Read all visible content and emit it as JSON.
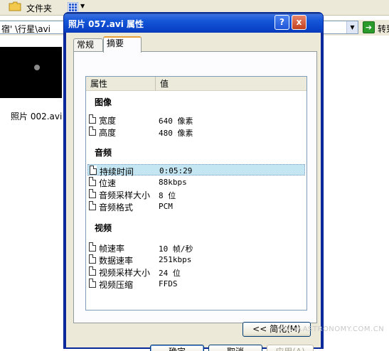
{
  "explorer": {
    "folders_label": "文件夹",
    "address": "宿' \\行星\\avi",
    "go_label": "转到",
    "thumbnail_label": "照片 002.avi"
  },
  "dialog": {
    "title": "照片 057.avi 属性",
    "help_glyph": "?",
    "close_glyph": "x",
    "tabs": [
      {
        "label": "常规"
      },
      {
        "label": "摘要",
        "active": true
      }
    ],
    "columns": {
      "property": "属性",
      "value": "值"
    },
    "groups": {
      "image": {
        "title": "图像",
        "rows": [
          {
            "label": "宽度",
            "value": "640 像素"
          },
          {
            "label": "高度",
            "value": "480 像素"
          }
        ]
      },
      "audio": {
        "title": "音频",
        "rows": [
          {
            "label": "持续时间",
            "value": "0:05:29",
            "selected": true
          },
          {
            "label": "位速",
            "value": "88kbps"
          },
          {
            "label": "音频采样大小",
            "value": "8 位"
          },
          {
            "label": "音频格式",
            "value": "PCM"
          }
        ]
      },
      "video": {
        "title": "视频",
        "rows": [
          {
            "label": "帧速率",
            "value": "10 帧/秒"
          },
          {
            "label": "数据速率",
            "value": "251kbps"
          },
          {
            "label": "视频采样大小",
            "value": "24 位"
          },
          {
            "label": "视频压缩",
            "value": "FFDS"
          }
        ]
      }
    },
    "buttons": {
      "simplify": "<< 简化(M)",
      "ok": "确定",
      "cancel": "取消",
      "apply": "应用(A)"
    }
  },
  "watermark": "WWW.ASTRONOMY.COM.CN",
  "colors": {
    "titlebar": "#1456d8",
    "selection": "#c3e6f2",
    "dialog_face": "#ece9d8"
  }
}
